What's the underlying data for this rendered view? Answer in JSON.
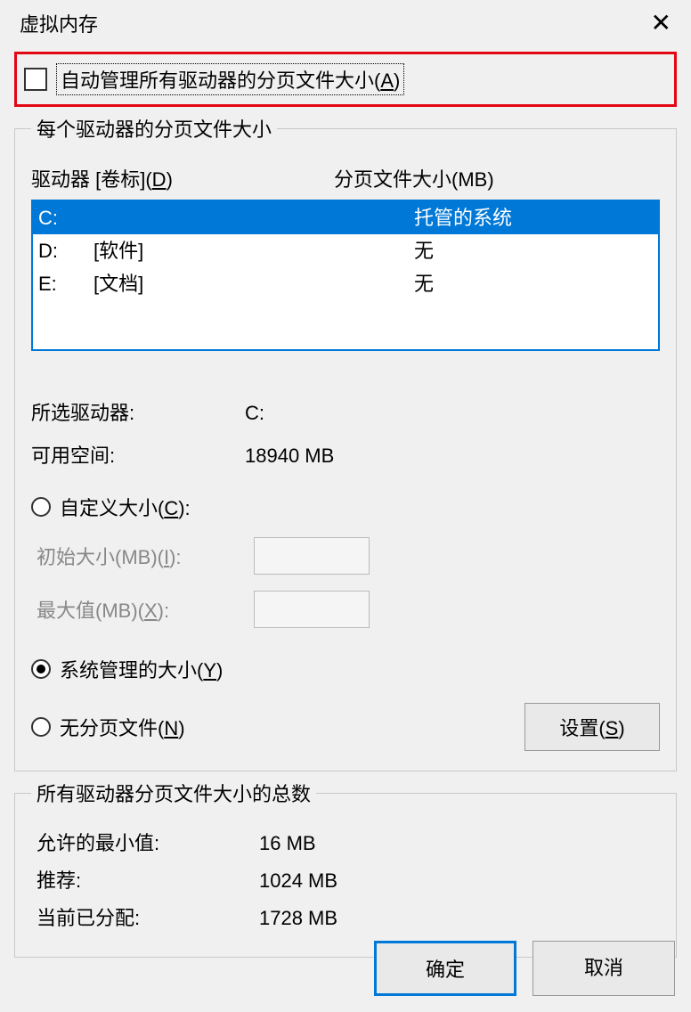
{
  "window": {
    "title": "虚拟内存",
    "close": "✕"
  },
  "auto_manage": {
    "label_pre": "自动管理所有驱动器的分页文件大小(",
    "label_u": "A",
    "label_post": ")",
    "checked": false
  },
  "group1": {
    "legend": "每个驱动器的分页文件大小",
    "header_drive_pre": "驱动器 [卷标](",
    "header_drive_u": "D",
    "header_drive_post": ")",
    "header_size": "分页文件大小(MB)",
    "drives": [
      {
        "letter": "C:",
        "label": "",
        "size": "托管的系统",
        "selected": true
      },
      {
        "letter": "D:",
        "label": "[软件]",
        "size": "无",
        "selected": false
      },
      {
        "letter": "E:",
        "label": "[文档]",
        "size": "无",
        "selected": false
      }
    ],
    "selected_label": "所选驱动器:",
    "selected_value": "C:",
    "free_label": "可用空间:",
    "free_value": "18940 MB",
    "radio_custom_pre": "自定义大小(",
    "radio_custom_u": "C",
    "radio_custom_post": "):",
    "initial_label_pre": "初始大小(MB)(",
    "initial_label_u": "I",
    "initial_label_post": "):",
    "max_label_pre": "最大值(MB)(",
    "max_label_u": "X",
    "max_label_post": "):",
    "radio_system_pre": "系统管理的大小(",
    "radio_system_u": "Y",
    "radio_system_post": ")",
    "radio_none_pre": "无分页文件(",
    "radio_none_u": "N",
    "radio_none_post": ")",
    "set_btn_pre": "设置(",
    "set_btn_u": "S",
    "set_btn_post": ")"
  },
  "group2": {
    "legend": "所有驱动器分页文件大小的总数",
    "min_label": "允许的最小值:",
    "min_value": "16 MB",
    "rec_label": "推荐:",
    "rec_value": "1024 MB",
    "cur_label": "当前已分配:",
    "cur_value": "1728 MB"
  },
  "footer": {
    "ok": "确定",
    "cancel": "取消"
  }
}
